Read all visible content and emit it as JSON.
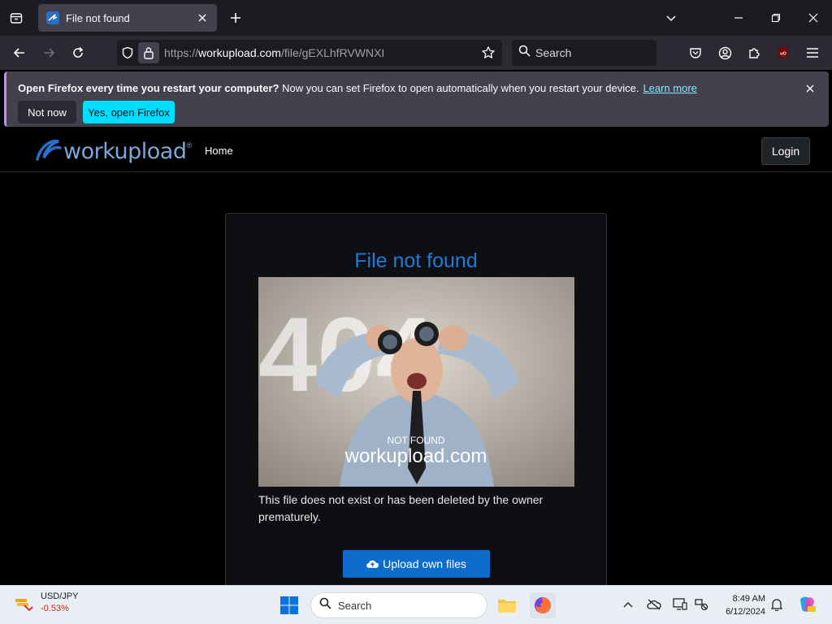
{
  "browser": {
    "tab_title": "File not found",
    "url_prefix": "https://",
    "url_host": "workupload.com",
    "url_path": "/file/gEXLhfRVWNXI",
    "search_placeholder": "Search"
  },
  "notification": {
    "bold_text": "Open Firefox every time you restart your computer?",
    "text": " Now you can set Firefox to open automatically when you restart your device.",
    "link": "Learn more",
    "not_now": "Not now",
    "yes": "Yes, open Firefox"
  },
  "site": {
    "logo_text": "workupload",
    "logo_mark": "®",
    "nav_home": "Home",
    "login": "Login"
  },
  "card": {
    "heading": "File not found",
    "image_caption_small": "NOT FOUND",
    "image_caption_big": "workupload.com",
    "image_bg_text": "404",
    "description": "This file does not exist or has been deleted by the owner prematurely.",
    "upload_button": "Upload own files"
  },
  "taskbar": {
    "widget_title": "USD/JPY",
    "widget_change": "-0.53%",
    "search_placeholder": "Search",
    "time": "8:49 AM",
    "date": "6/12/2024"
  },
  "colors": {
    "accent_blue": "#1f7ad8",
    "button_blue": "#0d6dcc",
    "firefox_cyan": "#00ddff"
  }
}
